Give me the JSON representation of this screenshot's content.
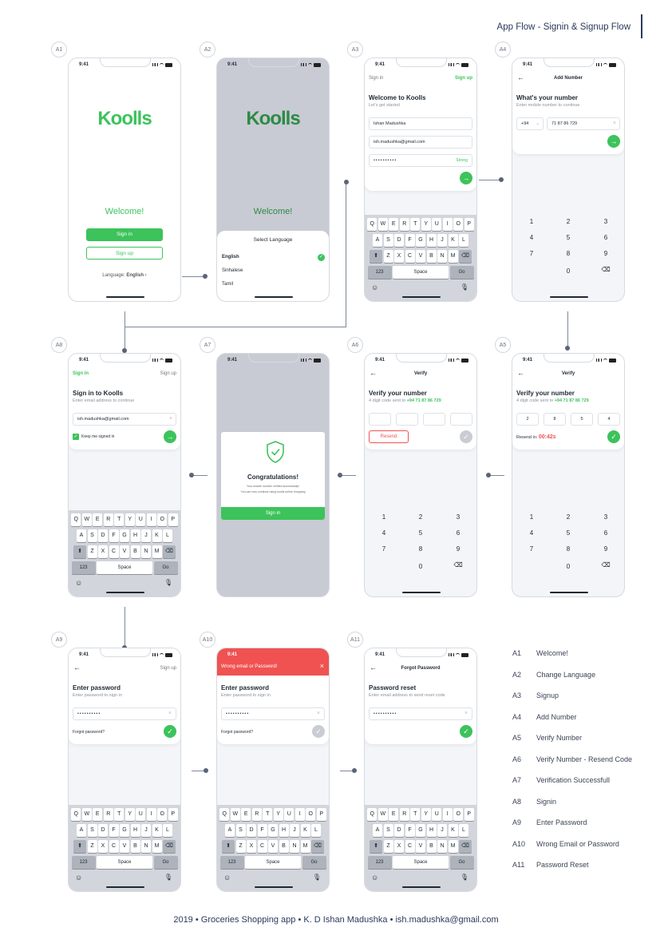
{
  "header": {
    "title": "App Flow - Signin & Signup Flow"
  },
  "tags": {
    "a1": "A1",
    "a2": "A2",
    "a3": "A3",
    "a4": "A4",
    "a5": "A5",
    "a6": "A6",
    "a7": "A7",
    "a8": "A8",
    "a9": "A9",
    "a10": "A10",
    "a11": "A11"
  },
  "status": {
    "time": "9:41"
  },
  "welcome": {
    "logo": "Koolls",
    "title": "Welcome!",
    "signin": "Sign in",
    "signup": "Sign up",
    "language_label": "Language:",
    "language_value": "English"
  },
  "language": {
    "title": "Select Language",
    "options": [
      "English",
      "Sinhalese",
      "Tamil"
    ]
  },
  "signup": {
    "top_left": "Sign in",
    "top_right": "Sign up",
    "title": "Welcome to Koolls",
    "subtitle": "Let's get started",
    "name": "Ishan Madushka",
    "email": "ish.madushka@gmail.com",
    "password": "••••••••••",
    "strength": "Strong"
  },
  "add_number": {
    "header": "Add Number",
    "title": "What's your number",
    "subtitle": "Enter mobile number to continue",
    "code": "+94",
    "number": "71 87 86 729"
  },
  "keyboard": {
    "row1": [
      "Q",
      "W",
      "E",
      "R",
      "T",
      "Y",
      "U",
      "I",
      "O",
      "P"
    ],
    "row2": [
      "A",
      "S",
      "D",
      "F",
      "G",
      "H",
      "J",
      "K",
      "L"
    ],
    "row3": [
      "Z",
      "X",
      "C",
      "V",
      "B",
      "N",
      "M"
    ],
    "k123": "123",
    "space": "Space",
    "go": "Go"
  },
  "numpad": [
    "1",
    "2",
    "3",
    "4",
    "5",
    "6",
    "7",
    "8",
    "9",
    "0"
  ],
  "verify": {
    "header": "Verify",
    "title": "Verify your number",
    "subtitle": "4 digit code sent to",
    "phone": "+94 71 87 86 729",
    "digits": [
      "2",
      "8",
      "5",
      "4"
    ],
    "resend_in": "Resend in:",
    "timer": "00:42s",
    "resend": "Resend"
  },
  "success": {
    "title": "Congratulations!",
    "line1": "Your mobile number verified successfully!",
    "line2": "You can now continue using koolls online shopping",
    "button": "Sign in"
  },
  "signin": {
    "top_left": "Sign in",
    "top_right": "Sign up",
    "title": "Sign in to Koolls",
    "subtitle": "Enter email address to continue",
    "email": "ish.madushka@gmail.com",
    "keep": "Keep me signed in"
  },
  "password": {
    "top_right": "Sign up",
    "title": "Enter password",
    "subtitle": "Enter password to sign in",
    "value": "••••••••••",
    "forgot": "Forgot password?",
    "error": "Wrong email or Password!"
  },
  "reset": {
    "header": "Forgot Password",
    "title": "Password reset",
    "subtitle": "Enter email address to send reset code",
    "value": "••••••••••"
  },
  "legend": [
    {
      "code": "A1",
      "name": "Welcome!"
    },
    {
      "code": "A2",
      "name": "Change Language"
    },
    {
      "code": "A3",
      "name": "Signup"
    },
    {
      "code": "A4",
      "name": "Add Number"
    },
    {
      "code": "A5",
      "name": "Verify Number"
    },
    {
      "code": "A6",
      "name": "Verify Number - Resend Code"
    },
    {
      "code": "A7",
      "name": "Verification Successfull"
    },
    {
      "code": "A8",
      "name": "Signin"
    },
    {
      "code": "A9",
      "name": "Enter Password"
    },
    {
      "code": "A10",
      "name": "Wrong Email or Password"
    },
    {
      "code": "A11",
      "name": "Password Reset"
    }
  ],
  "footer": {
    "text": "2019  •  Groceries Shopping app  •  K. D Ishan Madushka  •  ish.madushka@gmail.com"
  },
  "colors": {
    "green": "#3cc35b",
    "red": "#f05252",
    "navy": "#2a3a5c"
  }
}
